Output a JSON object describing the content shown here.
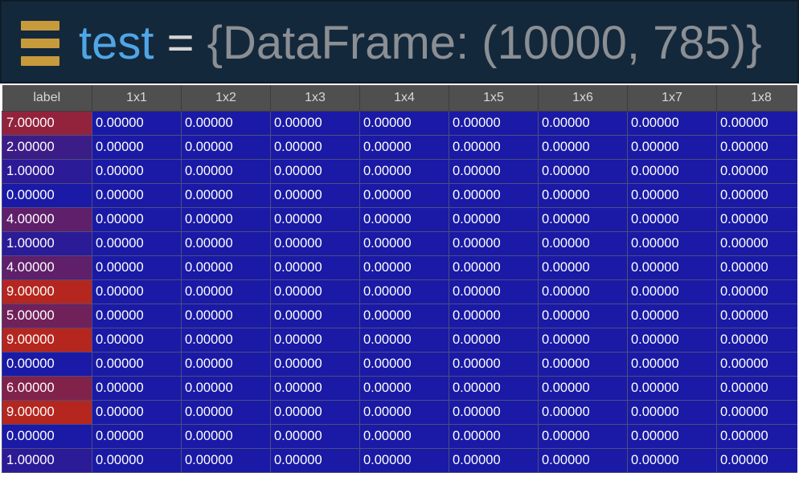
{
  "header": {
    "icon": "hamburger-menu-icon",
    "icon_color": "#c79a3c",
    "var_name": "test",
    "equals": " = ",
    "value": "{DataFrame: (10000, 785)}"
  },
  "table": {
    "columns": [
      "label",
      "1x1",
      "1x2",
      "1x3",
      "1x4",
      "1x5",
      "1x6",
      "1x7",
      "1x8"
    ],
    "rows": [
      [
        "7.00000",
        "0.00000",
        "0.00000",
        "0.00000",
        "0.00000",
        "0.00000",
        "0.00000",
        "0.00000",
        "0.00000"
      ],
      [
        "2.00000",
        "0.00000",
        "0.00000",
        "0.00000",
        "0.00000",
        "0.00000",
        "0.00000",
        "0.00000",
        "0.00000"
      ],
      [
        "1.00000",
        "0.00000",
        "0.00000",
        "0.00000",
        "0.00000",
        "0.00000",
        "0.00000",
        "0.00000",
        "0.00000"
      ],
      [
        "0.00000",
        "0.00000",
        "0.00000",
        "0.00000",
        "0.00000",
        "0.00000",
        "0.00000",
        "0.00000",
        "0.00000"
      ],
      [
        "4.00000",
        "0.00000",
        "0.00000",
        "0.00000",
        "0.00000",
        "0.00000",
        "0.00000",
        "0.00000",
        "0.00000"
      ],
      [
        "1.00000",
        "0.00000",
        "0.00000",
        "0.00000",
        "0.00000",
        "0.00000",
        "0.00000",
        "0.00000",
        "0.00000"
      ],
      [
        "4.00000",
        "0.00000",
        "0.00000",
        "0.00000",
        "0.00000",
        "0.00000",
        "0.00000",
        "0.00000",
        "0.00000"
      ],
      [
        "9.00000",
        "0.00000",
        "0.00000",
        "0.00000",
        "0.00000",
        "0.00000",
        "0.00000",
        "0.00000",
        "0.00000"
      ],
      [
        "5.00000",
        "0.00000",
        "0.00000",
        "0.00000",
        "0.00000",
        "0.00000",
        "0.00000",
        "0.00000",
        "0.00000"
      ],
      [
        "9.00000",
        "0.00000",
        "0.00000",
        "0.00000",
        "0.00000",
        "0.00000",
        "0.00000",
        "0.00000",
        "0.00000"
      ],
      [
        "0.00000",
        "0.00000",
        "0.00000",
        "0.00000",
        "0.00000",
        "0.00000",
        "0.00000",
        "0.00000",
        "0.00000"
      ],
      [
        "6.00000",
        "0.00000",
        "0.00000",
        "0.00000",
        "0.00000",
        "0.00000",
        "0.00000",
        "0.00000",
        "0.00000"
      ],
      [
        "9.00000",
        "0.00000",
        "0.00000",
        "0.00000",
        "0.00000",
        "0.00000",
        "0.00000",
        "0.00000",
        "0.00000"
      ],
      [
        "0.00000",
        "0.00000",
        "0.00000",
        "0.00000",
        "0.00000",
        "0.00000",
        "0.00000",
        "0.00000",
        "0.00000"
      ],
      [
        "1.00000",
        "0.00000",
        "0.00000",
        "0.00000",
        "0.00000",
        "0.00000",
        "0.00000",
        "0.00000",
        "0.00000"
      ]
    ],
    "colors": {
      "low": "#1a1aa6",
      "high": "#b5261e",
      "header_bg": "#4f4f4f",
      "header_text": "#d8d8d8"
    },
    "label_color_range": [
      0,
      9
    ]
  }
}
